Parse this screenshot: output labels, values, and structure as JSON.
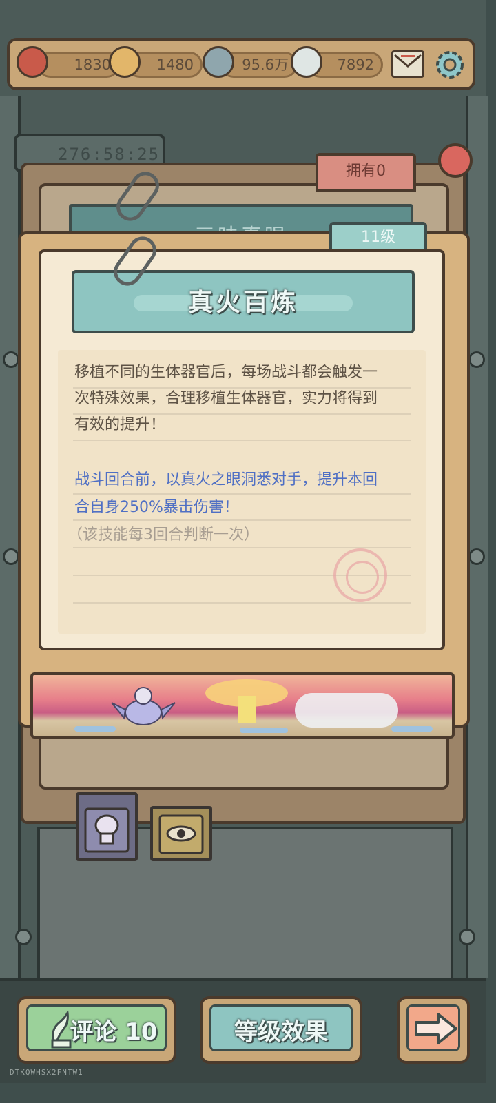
{
  "topbar": {
    "resources": [
      {
        "icon": "heart-icon",
        "value": "1830"
      },
      {
        "icon": "wing-icon",
        "value": "1480"
      },
      {
        "icon": "ghost-icon",
        "value": "95.6万"
      },
      {
        "icon": "speech-bubble-icon",
        "value": "7892"
      }
    ],
    "mail_icon": "mail-icon",
    "settings_icon": "gear-icon"
  },
  "background": {
    "timer": "276:58:25",
    "owned_label": "拥有0",
    "hidden_title": "三味真眼"
  },
  "card": {
    "level": "11级",
    "title": "真火百炼",
    "description": [
      "移植不同的生体器官后，每场战斗都会触发一",
      "次特殊效果，合理移植生体器官，实力将得到",
      "有效的提升！"
    ],
    "effect": [
      "战斗回合前，以真火之眼洞悉对手，提升本回",
      "合自身250%暴击伤害！"
    ],
    "note": "（该技能每3回合判断一次）"
  },
  "tabs": [
    {
      "icon": "brain-icon"
    },
    {
      "icon": "eye-icon"
    }
  ],
  "buttons": {
    "comment_label": "评论 10",
    "level_effect_label": "等级效果",
    "next_icon": "arrow-right-icon"
  },
  "footer_code": "DTKQWHSX2FNTW1",
  "colors": {
    "effect_text": "#4f6fc4",
    "title_plate": "#8ec5c1",
    "comment_button": "#9bd19a",
    "next_button": "#f2a88a"
  }
}
